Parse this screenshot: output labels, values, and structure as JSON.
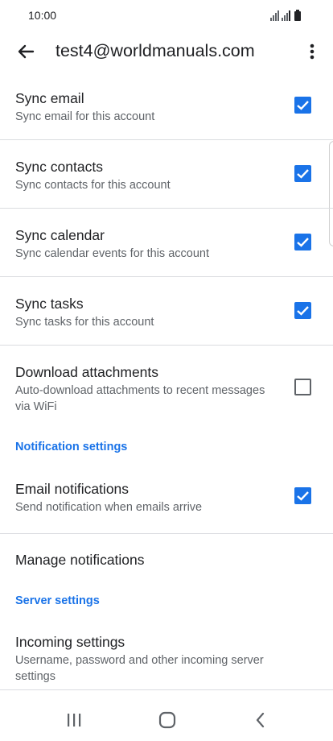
{
  "status_bar": {
    "time": "10:00"
  },
  "header": {
    "title": "test4@worldmanuals.com"
  },
  "settings": [
    {
      "title": "Sync email",
      "subtitle": "Sync email for this account",
      "checked": true
    },
    {
      "title": "Sync contacts",
      "subtitle": "Sync contacts for this account",
      "checked": true
    },
    {
      "title": "Sync calendar",
      "subtitle": "Sync calendar events for this account",
      "checked": true
    },
    {
      "title": "Sync tasks",
      "subtitle": "Sync tasks for this account",
      "checked": true
    },
    {
      "title": "Download attachments",
      "subtitle": "Auto-download attachments to recent messages via WiFi",
      "checked": false
    }
  ],
  "notification_section": {
    "heading": "Notification settings",
    "email_notifications": {
      "title": "Email notifications",
      "subtitle": "Send notification when emails arrive",
      "checked": true
    },
    "manage_notifications": {
      "title": "Manage notifications"
    }
  },
  "server_section": {
    "heading": "Server settings",
    "incoming": {
      "title": "Incoming settings",
      "subtitle": "Username, password and other incoming server settings"
    }
  },
  "icons": {
    "back": "arrow-back-icon",
    "overflow": "more-vert-icon",
    "nav_recents": "recents-icon",
    "nav_home": "home-icon",
    "nav_back": "nav-back-icon"
  },
  "colors": {
    "accent": "#1a73e8",
    "divider": "#dadce0",
    "secondary_text": "#5f6368"
  }
}
